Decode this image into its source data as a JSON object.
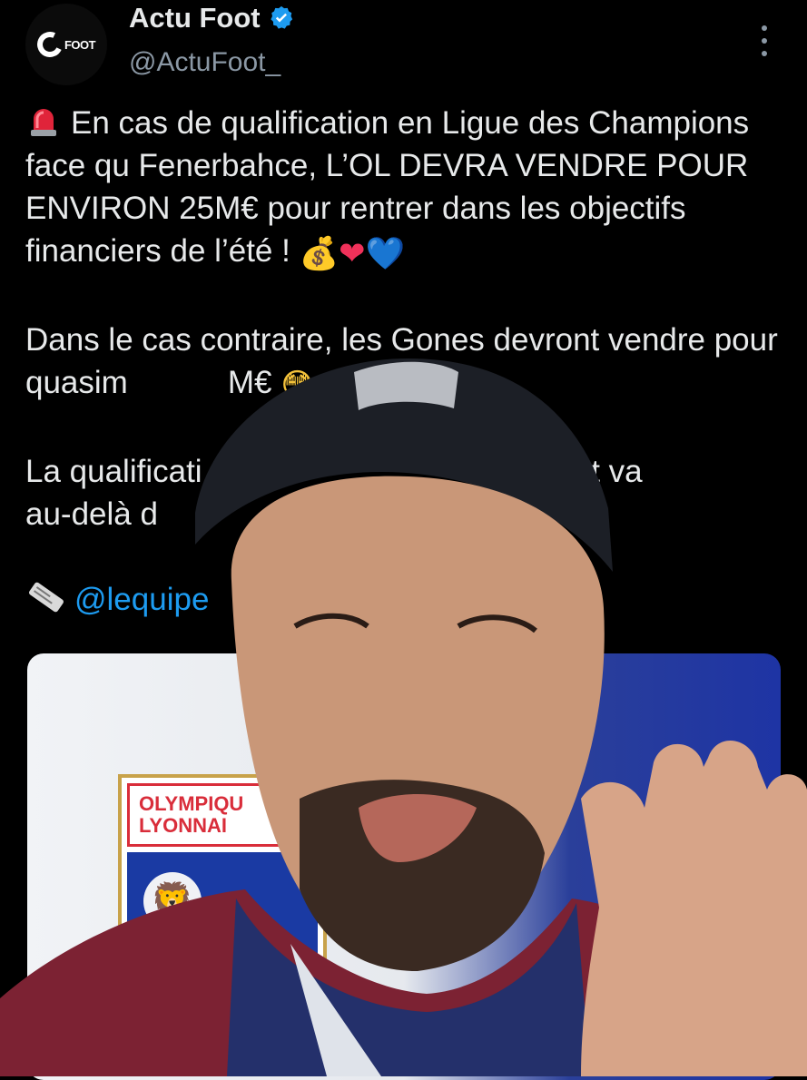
{
  "tweet": {
    "author": {
      "display_name": "Actu Foot",
      "handle": "@ActuFoot_",
      "avatar_text": "FOOT",
      "verified": true
    },
    "body": {
      "p1_text": "En cas de qualification en Ligue des Champions face qu Fenerbahce, L’OL DEVRA VENDRE POUR ENVIRON 25M€ pour rentrer dans les objectifs financiers de l’été !",
      "p1_emojis": [
        "💰",
        "❤",
        "💙"
      ],
      "p2_text": "Dans le cas contraire, les Gones devront vendre pour quasim",
      "p2_tail": "M€",
      "p2_emoji": "😳",
      "p3_line1_a": "La qualificati",
      "p3_line1_b": "e et va",
      "p3_line2": "au-delà d",
      "source_mention": "@lequipe"
    },
    "media": {
      "crest_line1": "OLYMPIQU",
      "crest_line2": "LYONNAI"
    }
  },
  "colors": {
    "background": "#000000",
    "text": "#e7e9ea",
    "muted": "#8b98a5",
    "accent": "#1d9bf0"
  },
  "icons": [
    "verified-badge-icon",
    "more-options-icon",
    "siren-icon",
    "newspaper-icon"
  ]
}
